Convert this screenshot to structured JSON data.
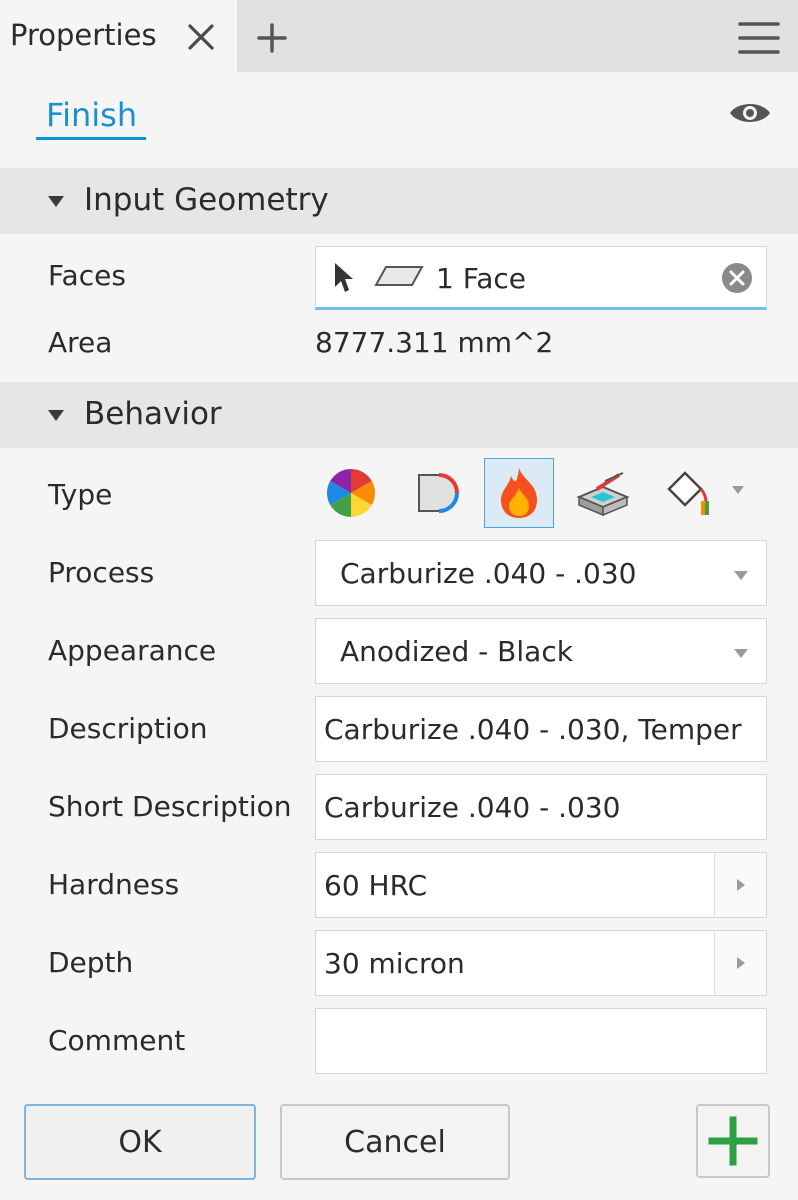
{
  "tabbar": {
    "tab_label": "Properties",
    "close_icon": "close-icon",
    "add_icon": "plus-icon",
    "menu_icon": "hamburger-menu-icon"
  },
  "header": {
    "finish_label": "Finish",
    "visibility_icon": "eye-icon"
  },
  "input_geometry": {
    "title": "Input Geometry",
    "faces_label": "Faces",
    "faces_value": "1 Face",
    "area_label": "Area",
    "area_value": "8777.311 mm^2"
  },
  "behavior": {
    "title": "Behavior",
    "type_label": "Type",
    "type_options": [
      "color-wheel-icon",
      "material-coating-icon",
      "flame-icon",
      "paint-tray-icon",
      "paint-bucket-icon"
    ],
    "type_selected_index": 2,
    "process_label": "Process",
    "process_value": "Carburize .040 - .030",
    "appearance_label": "Appearance",
    "appearance_value": "Anodized - Black",
    "description_label": "Description",
    "description_value": "Carburize .040 - .030, Temper",
    "short_description_label": "Short Description",
    "short_description_value": "Carburize .040 - .030",
    "hardness_label": "Hardness",
    "hardness_value": "60 HRC",
    "depth_label": "Depth",
    "depth_value": "30 micron",
    "comment_label": "Comment",
    "comment_value": ""
  },
  "footer": {
    "ok_label": "OK",
    "cancel_label": "Cancel",
    "add_icon": "green-plus-icon"
  },
  "colors": {
    "accent": "#0696d7",
    "add_green": "#2ea043"
  }
}
